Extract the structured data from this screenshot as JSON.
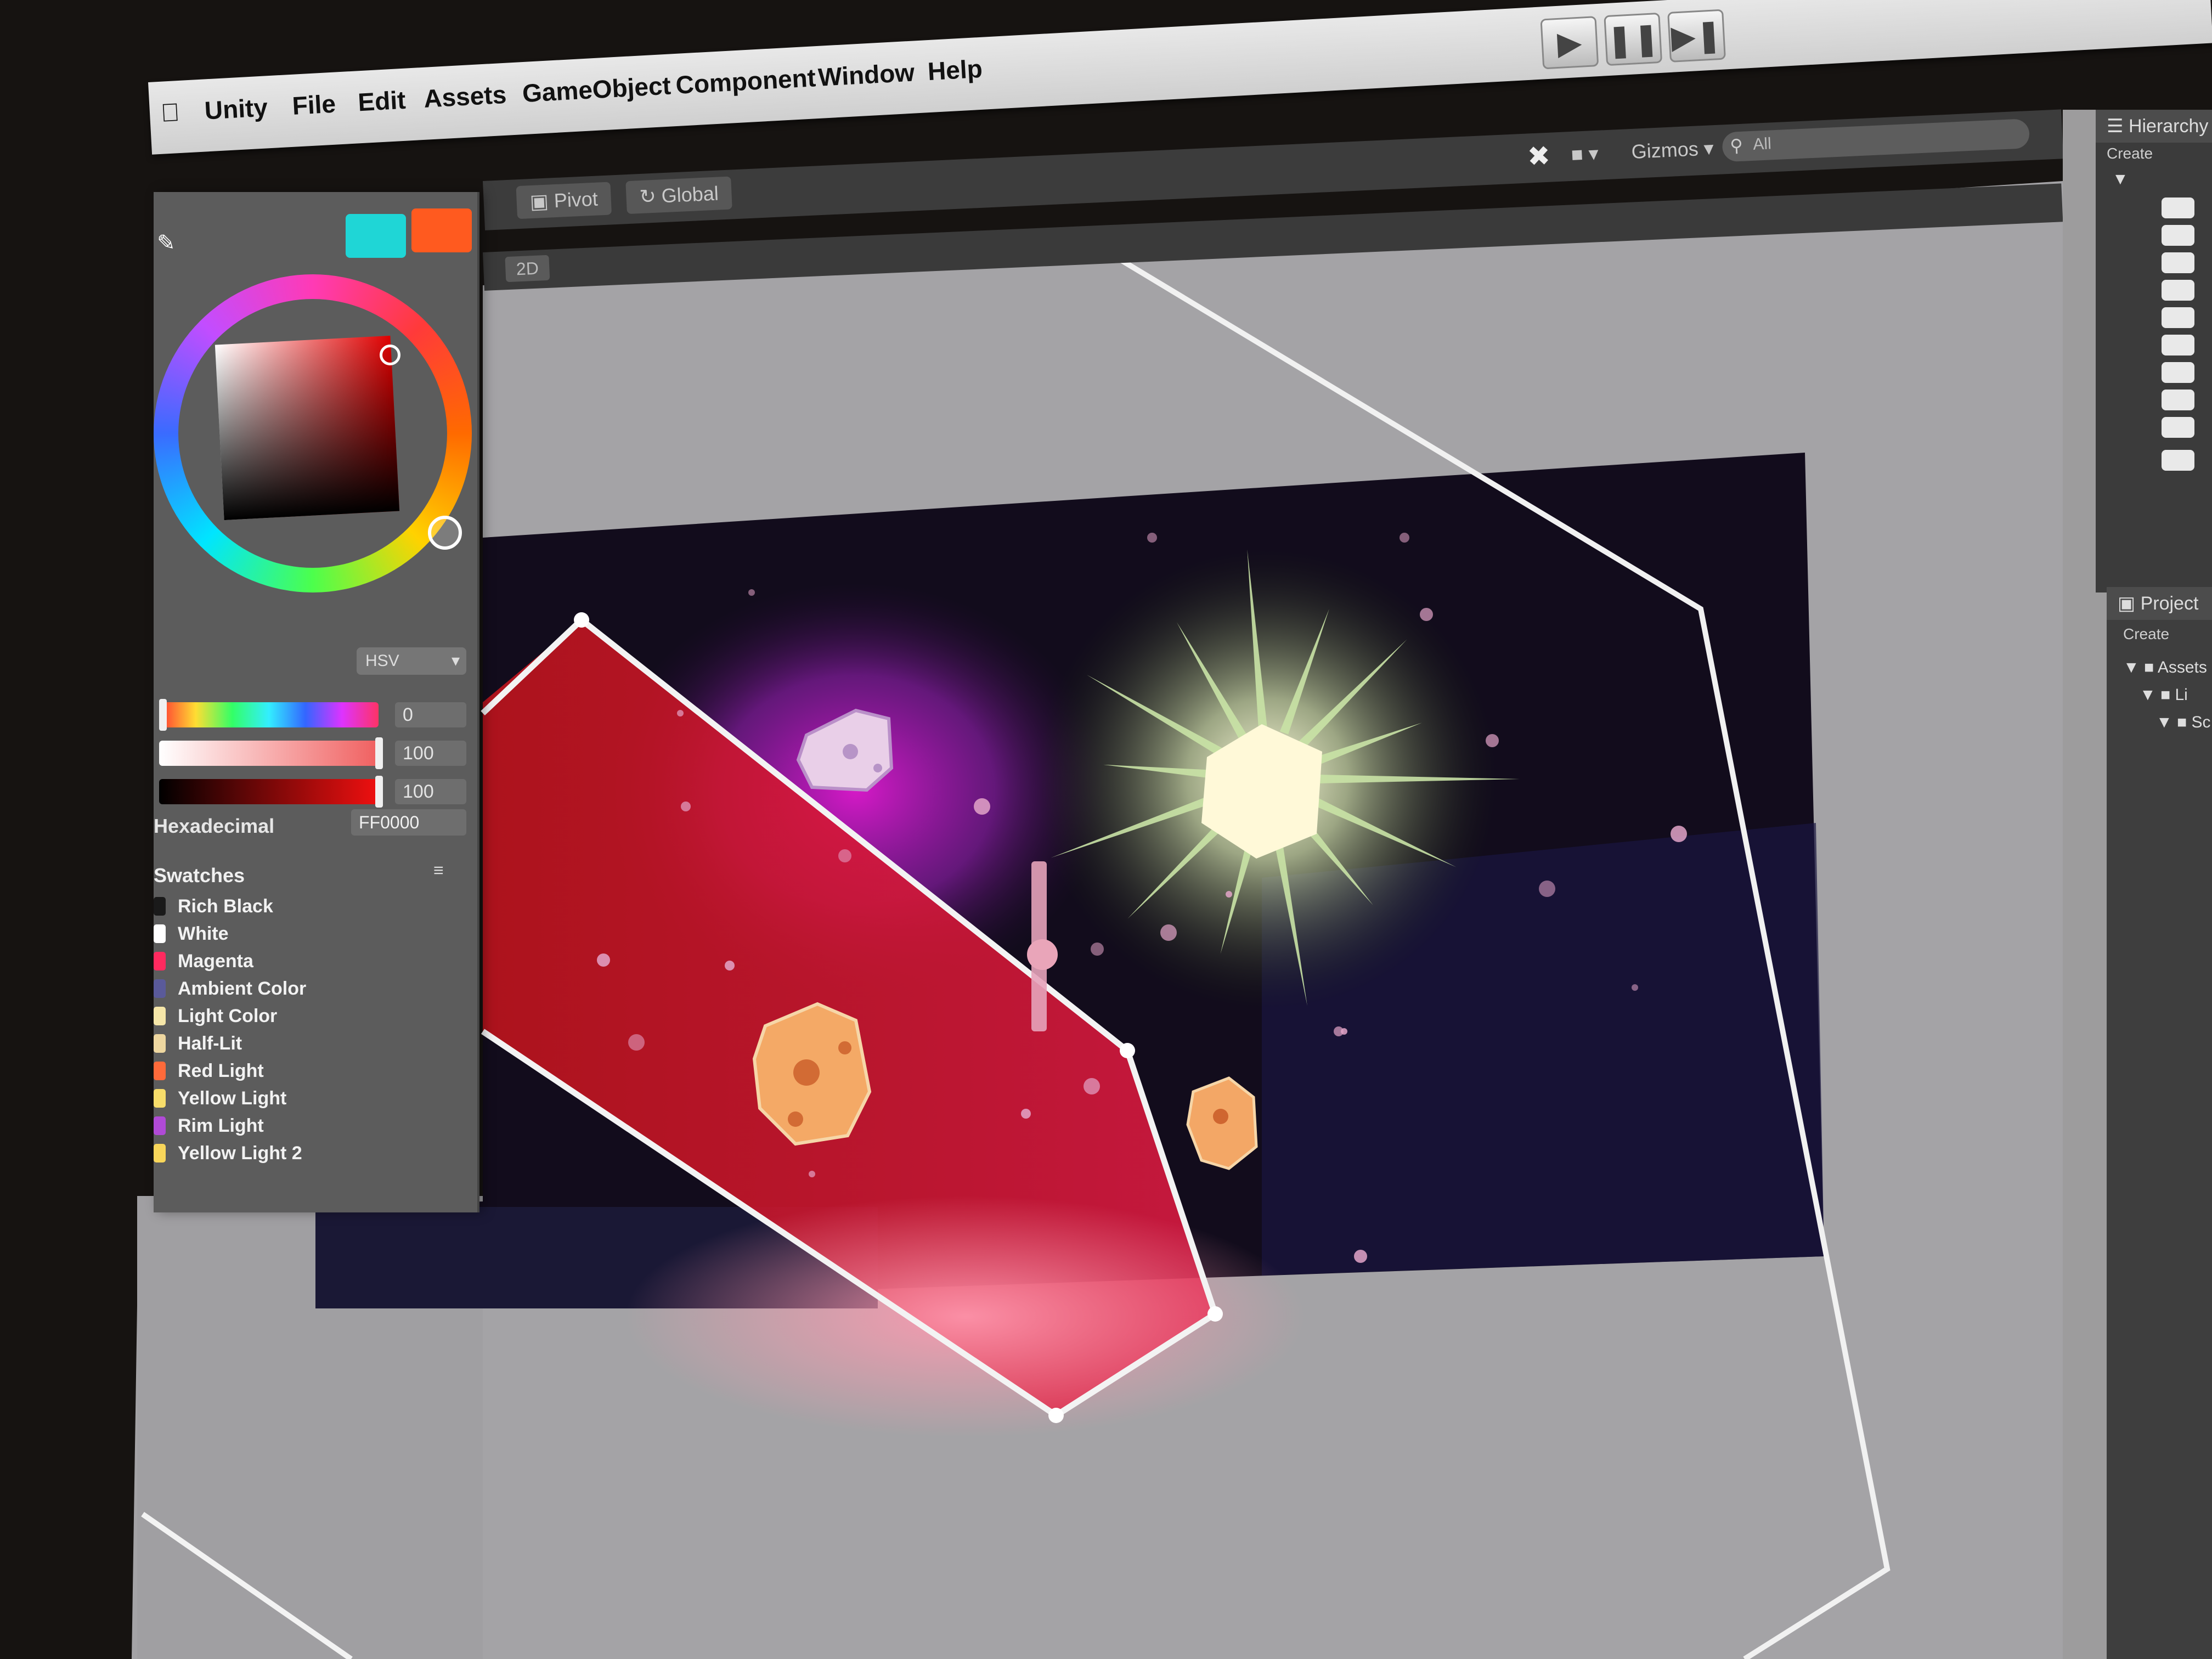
{
  "menu": {
    "items": [
      "Unity",
      "File",
      "Edit",
      "Assets",
      "GameObject",
      "Component",
      "Window",
      "Help"
    ]
  },
  "toolbar": {
    "pivot_label": "Pivot",
    "global_label": "Global",
    "gizmos_label": "Gizmos",
    "search_placeholder": "All",
    "layer_label": "2D"
  },
  "play_controls": {
    "play_icon": "play-icon",
    "pause_icon": "pause-icon",
    "step_icon": "step-icon"
  },
  "color_picker": {
    "current_color": "#1fd6d6",
    "previous_color": "#ff5a1f",
    "mode": "HSV",
    "hue_value": "0",
    "saturation_value": "100",
    "value_value": "100",
    "hex_label": "Hexadecimal",
    "hex_value": "FF0000",
    "swatches_title": "Swatches",
    "swatches_menu": "≡",
    "swatches": [
      {
        "name": "Rich Black",
        "color": "#1a1a1a"
      },
      {
        "name": "White",
        "color": "#ffffff"
      },
      {
        "name": "Magenta",
        "color": "#ff2a5f"
      },
      {
        "name": "Ambient Color",
        "color": "#5a5a9a"
      },
      {
        "name": "Light Color",
        "color": "#f5e6a8"
      },
      {
        "name": "Half-Lit",
        "color": "#eed7a0"
      },
      {
        "name": "Red Light",
        "color": "#ff6a3a"
      },
      {
        "name": "Yellow Light",
        "color": "#f7dd6a"
      },
      {
        "name": "Rim Light",
        "color": "#b04ad6"
      },
      {
        "name": "Yellow Light 2",
        "color": "#f8d65a"
      }
    ]
  },
  "hierarchy": {
    "title": "Hierarchy",
    "create_label": "Create"
  },
  "project": {
    "title": "Project",
    "create_label": "Create",
    "rows": [
      "Assets",
      "Li",
      "Sc"
    ]
  }
}
